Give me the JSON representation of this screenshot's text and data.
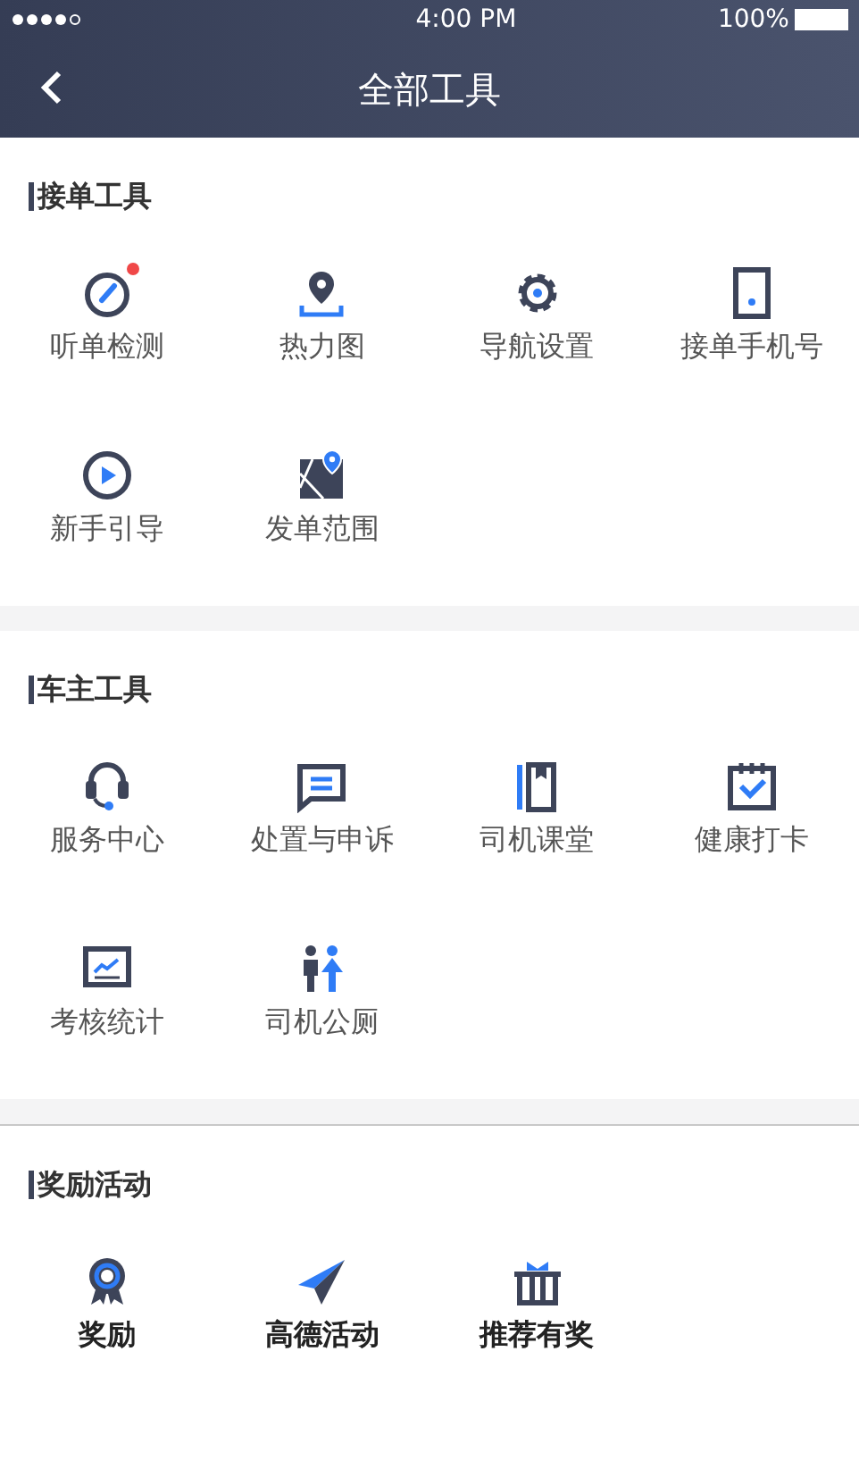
{
  "status_bar": {
    "time": "4:00 PM",
    "battery": "100%"
  },
  "nav": {
    "title": "全部工具"
  },
  "sections": [
    {
      "title": "接单工具",
      "bold_labels": false,
      "items": [
        {
          "label": "听单检测",
          "kind": "gauge",
          "dot": true
        },
        {
          "label": "热力图",
          "kind": "pin",
          "dot": false
        },
        {
          "label": "导航设置",
          "kind": "gear",
          "dot": false
        },
        {
          "label": "接单手机号",
          "kind": "phone",
          "dot": false
        },
        {
          "label": "新手引导",
          "kind": "play",
          "dot": false
        },
        {
          "label": "发单范围",
          "kind": "map",
          "dot": false
        }
      ]
    },
    {
      "title": "车主工具",
      "bold_labels": false,
      "items": [
        {
          "label": "服务中心",
          "kind": "headset",
          "dot": false
        },
        {
          "label": "处置与申诉",
          "kind": "message",
          "dot": false
        },
        {
          "label": "司机课堂",
          "kind": "book",
          "dot": false
        },
        {
          "label": "健康打卡",
          "kind": "calendar",
          "dot": false
        },
        {
          "label": "考核统计",
          "kind": "chart",
          "dot": false
        },
        {
          "label": "司机公厕",
          "kind": "toilet",
          "dot": false
        }
      ]
    },
    {
      "title": "奖励活动",
      "bold_labels": true,
      "items": [
        {
          "label": "奖励",
          "kind": "medal",
          "dot": false
        },
        {
          "label": "高德活动",
          "kind": "plane",
          "dot": false
        },
        {
          "label": "推荐有奖",
          "kind": "gift",
          "dot": false
        }
      ]
    }
  ]
}
